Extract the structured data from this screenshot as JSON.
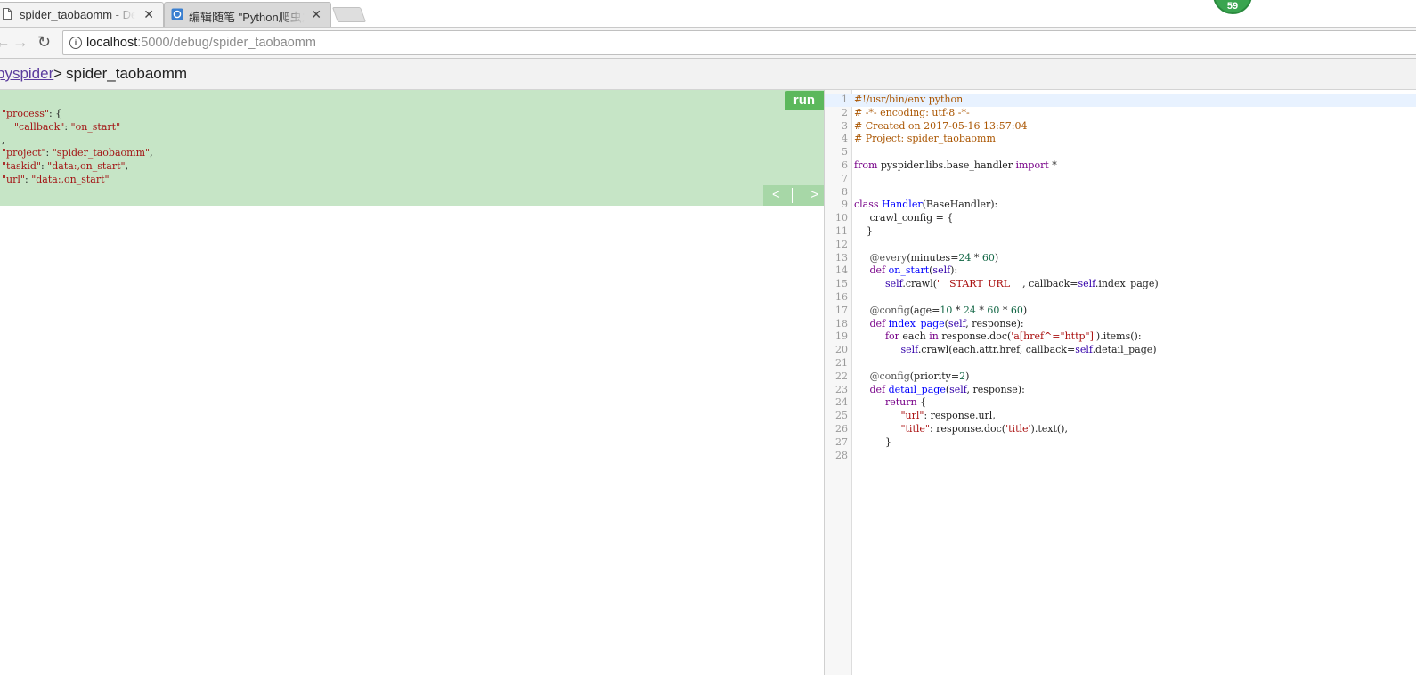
{
  "browser": {
    "tabs": [
      {
        "title": "spider_taobaomm - De"
      },
      {
        "title": "编辑随笔 \"Python爬虫之"
      }
    ],
    "badge": "59",
    "url_host": "localhost",
    "url_rest": ":5000/debug/spider_taobaomm"
  },
  "header": {
    "root_link": "pyspider",
    "separator": ">",
    "project": "spider_taobaomm"
  },
  "task_panel": {
    "run_label": "run",
    "prev_label": "<",
    "next_label": ">",
    "json": {
      "l1_key": "\"process\"",
      "l2_key": "\"callback\"",
      "l2_val": "\"on_start\"",
      "l4_key": "\"project\"",
      "l4_val": "\"spider_taobaomm\"",
      "l5_key": "\"taskid\"",
      "l5_val": "\"data:,on_start\"",
      "l6_key": "\"url\"",
      "l6_val": "\"data:,on_start\""
    }
  },
  "editor": {
    "line_numbers": [
      "1",
      "2",
      "3",
      "4",
      "5",
      "6",
      "7",
      "8",
      "9",
      "10",
      "11",
      "12",
      "13",
      "14",
      "15",
      "16",
      "17",
      "18",
      "19",
      "20",
      "21",
      "22",
      "23",
      "24",
      "25",
      "26",
      "27",
      "28"
    ],
    "tokens": {
      "shebang": "#!/usr/bin/env python",
      "encoding": "# -*- encoding: utf-8 -*-",
      "created": "# Created on 2017-05-16 13:57:04",
      "project": "# Project: spider_taobaomm",
      "kw_from": "from",
      "module": " pyspider.libs.base_handler ",
      "kw_import": "import",
      "star": " *",
      "kw_class": "class",
      "cls_name": "Handler",
      "cls_base": "(BaseHandler):",
      "crawl_config": "crawl_config = {",
      "brace_close": "}",
      "deco_every": "@every",
      "every_a": "(minutes=",
      "n24": "24",
      "times": " * ",
      "n60": "60",
      "paren_close": ")",
      "kw_def": "def",
      "on_start": "on_start",
      "paren_open": "(",
      "self": "self",
      "paren_colon": "):",
      "self_crawl_a": ".crawl(",
      "start_url": "'__START_URL__'",
      "callback_eq": ", callback=",
      "index_page_ref": ".index_page)",
      "deco_config": "@config",
      "age_eq": "(age=",
      "n10": "10",
      "index_page": "index_page",
      "self_response": ", response):",
      "kw_for": "for",
      "each": " each ",
      "kw_in": "in",
      "resp_doc": " response.doc(",
      "selector": "'a[href^=\"http\"]'",
      "items": ").items():",
      "crawl_each": ".crawl(each.attr.href, callback=",
      "detail_page_ref": ".detail_page)",
      "priority_eq": "(priority=",
      "n2": "2",
      "detail_page": "detail_page",
      "kw_return": "return",
      "brace_open": " {",
      "url_key": "\"url\"",
      "url_val": ": response.url,",
      "title_key": "\"title\"",
      "title_a": ": response.doc(",
      "title_sel": "'title'",
      "title_b": ").text(),"
    }
  }
}
